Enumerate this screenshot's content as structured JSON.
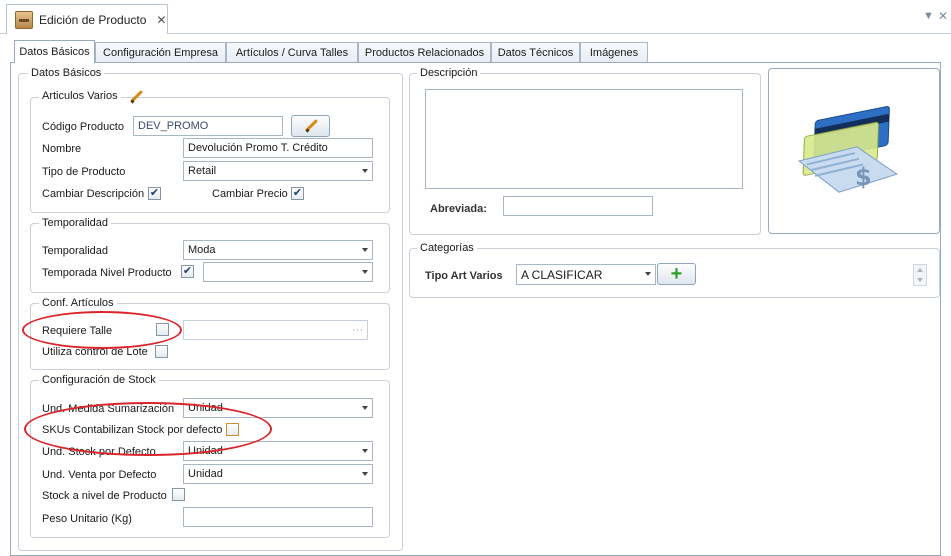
{
  "document_tab": {
    "title": "Edición de Producto",
    "close_glyph": "✕"
  },
  "strip_controls": {
    "dropdown_glyph": "▼",
    "close_glyph": "✕"
  },
  "tabs": [
    {
      "label": "Datos Básicos",
      "active": true
    },
    {
      "label": "Configuración Empresa"
    },
    {
      "label": "Artículos / Curva Talles"
    },
    {
      "label": "Productos Relacionados"
    },
    {
      "label": "Datos Técnicos"
    },
    {
      "label": "Imágenes"
    }
  ],
  "datos_basicos": {
    "legend": "Datos Básicos",
    "articulos_varios": {
      "legend": "Articulos Varios",
      "codigo_label": "Código Producto",
      "codigo_value": "DEV_PROMO",
      "nombre_label": "Nombre",
      "nombre_value": "Devolución Promo T. Crédito",
      "tipo_label": "Tipo de Producto",
      "tipo_value": "Retail",
      "cambiar_desc_label": "Cambiar Descripción",
      "cambiar_desc_checked": "✔",
      "cambiar_precio_label": "Cambiar Precio",
      "cambiar_precio_checked": "✔"
    },
    "temporalidad": {
      "legend": "Temporalidad",
      "temporalidad_label": "Temporalidad",
      "temporalidad_value": "Moda",
      "temporada_label": "Temporada Nivel Producto",
      "temporada_checked": "✔",
      "temporada_value": ""
    },
    "conf_articulos": {
      "legend": "Conf. Artículos",
      "requiere_talle_label": "Requiere Talle",
      "requiere_talle_ellipsis": "···",
      "lote_label": "Utiliza control de Lote"
    },
    "stock": {
      "legend": "Configuración de Stock",
      "medida_label": "Und. Medida Sumarización",
      "medida_value": "Unidad",
      "skus_label": "SKUs Contabilizan Stock por defecto",
      "stock_defecto_label": "Und. Stock por Defecto",
      "stock_defecto_value": "Unidad",
      "venta_defecto_label": "Und. Venta por Defecto",
      "venta_defecto_value": "Unidad",
      "stock_producto_label": "Stock a nivel de Producto",
      "peso_label": "Peso Unitario (Kg)",
      "peso_value": ""
    }
  },
  "descripcion": {
    "legend": "Descripción",
    "value": "",
    "abreviada_label": "Abreviada:",
    "abreviada_value": ""
  },
  "categorias": {
    "legend": "Categorías",
    "tipo_label": "Tipo Art Varios",
    "tipo_value": "A CLASIFICAR",
    "add_glyph": "+"
  },
  "image_icon": {
    "name": "credit-card-check-icon",
    "symbol": "$"
  },
  "colors": {
    "annotation": "#d9262a",
    "tab_border": "#9aa9bd",
    "add_green": "#2e9e2e"
  }
}
